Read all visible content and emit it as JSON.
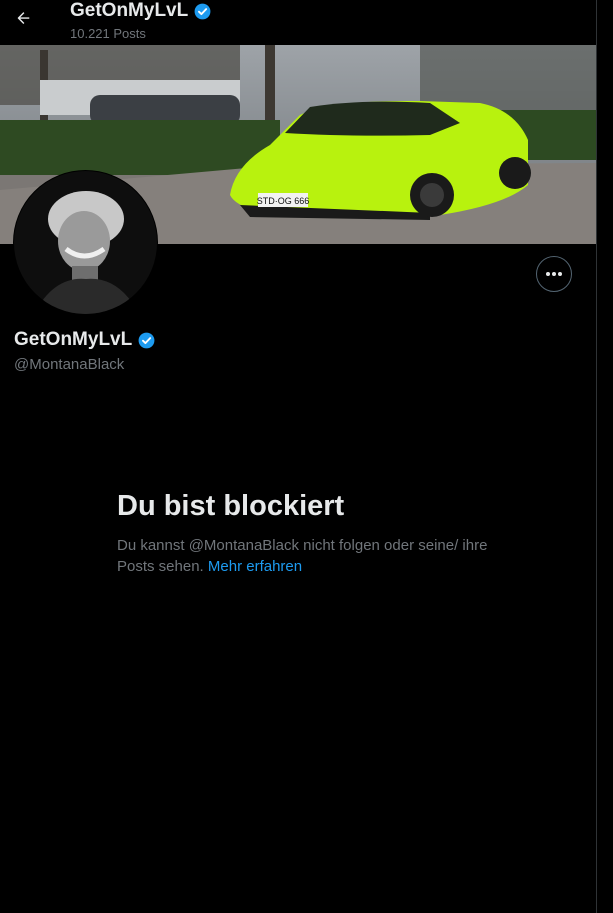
{
  "header": {
    "title": "GetOnMyLvL",
    "posts_count": "10.221 Posts"
  },
  "banner": {
    "plate_text": "STD·OG 666"
  },
  "profile": {
    "name": "GetOnMyLvL",
    "handle": "@MontanaBlack"
  },
  "blocked": {
    "title": "Du bist blockiert",
    "text": "Du kannst @MontanaBlack nicht folgen oder seine/ ihre Posts sehen.",
    "link": "Mehr erfahren"
  },
  "colors": {
    "background": "#000000",
    "accent": "#1d9bf0",
    "muted": "#71767b",
    "car": "#b8f20e"
  },
  "icons": {
    "back": "arrow-left-icon",
    "verified": "verified-badge-icon",
    "more": "more-horizontal-icon"
  }
}
